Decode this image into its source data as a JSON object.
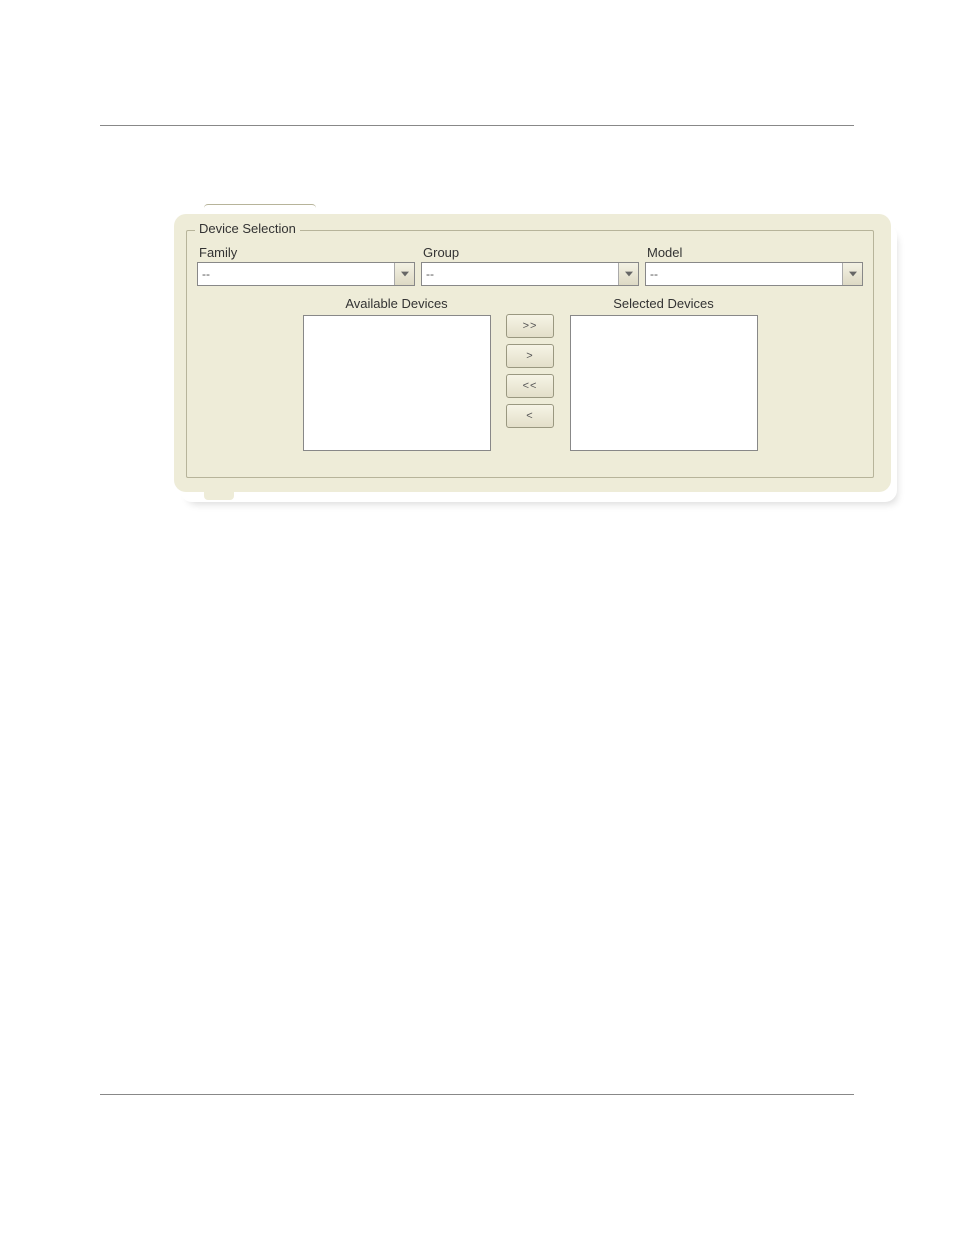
{
  "fieldset": {
    "legend": "Device Selection"
  },
  "filters": {
    "family": {
      "label": "Family",
      "value": "--"
    },
    "group": {
      "label": "Group",
      "value": "--"
    },
    "model": {
      "label": "Model",
      "value": "--"
    }
  },
  "lists": {
    "available_label": "Available Devices",
    "selected_label": "Selected Devices"
  },
  "buttons": {
    "add_all": ">>",
    "add": ">",
    "remove_all": "<<",
    "remove": "<"
  }
}
